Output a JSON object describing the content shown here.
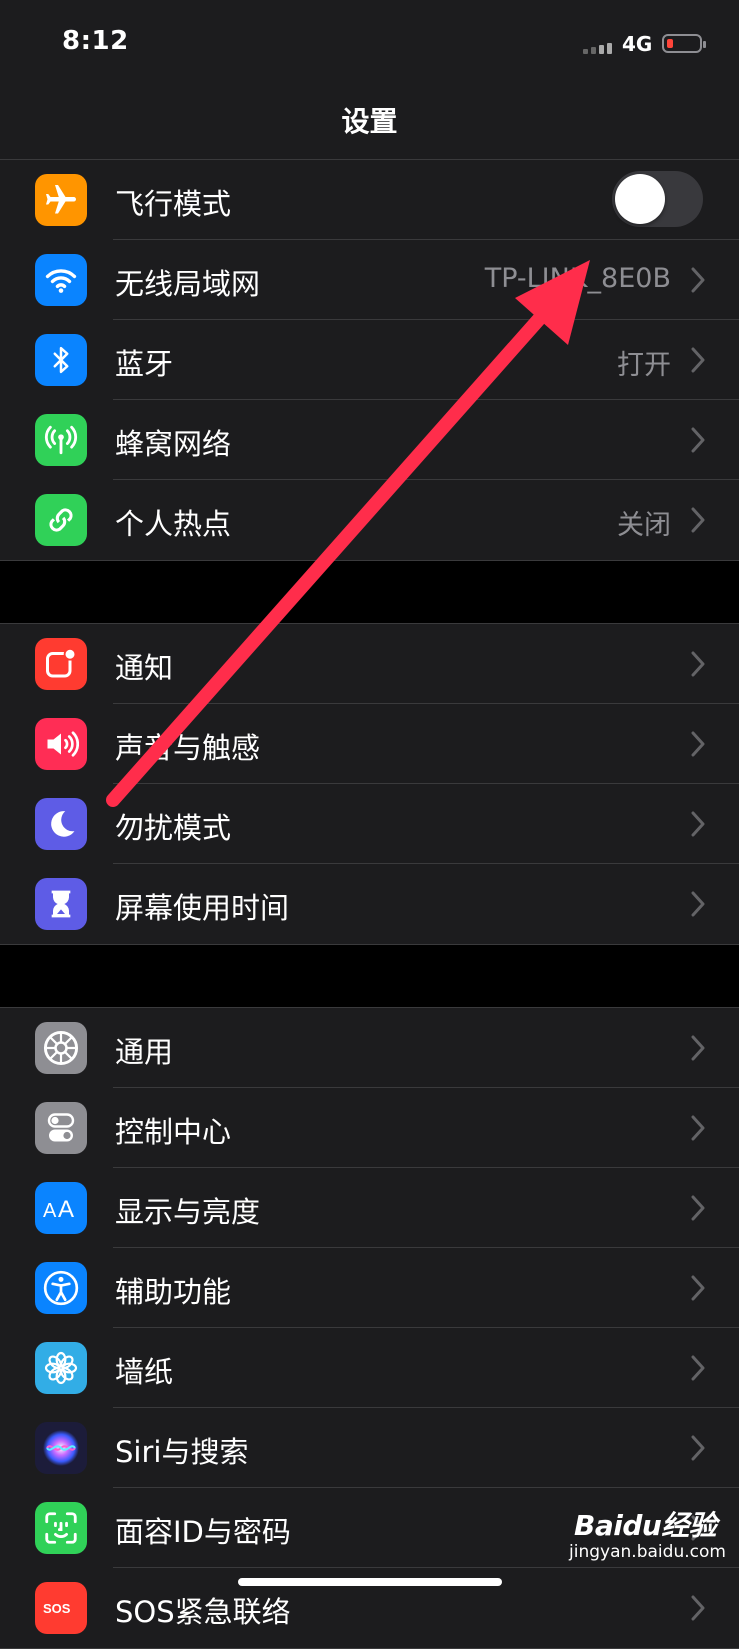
{
  "status_bar": {
    "time": "8:12",
    "network": "4G"
  },
  "nav": {
    "title": "设置"
  },
  "groups": [
    {
      "rows": [
        {
          "key": "airplane",
          "label": "飞行模式",
          "icon": "airplane-icon",
          "icon_color": "#ff9500",
          "toggle": false
        },
        {
          "key": "wifi",
          "label": "无线局域网",
          "value": "TP-LINK_8E0B",
          "icon": "wifi-icon",
          "icon_color": "#0a84ff"
        },
        {
          "key": "bluetooth",
          "label": "蓝牙",
          "value": "打开",
          "icon": "bluetooth-icon",
          "icon_color": "#0a84ff"
        },
        {
          "key": "cellular",
          "label": "蜂窝网络",
          "icon": "antenna-icon",
          "icon_color": "#30d158"
        },
        {
          "key": "hotspot",
          "label": "个人热点",
          "value": "关闭",
          "icon": "hotspot-chain-icon",
          "icon_color": "#30d158"
        }
      ]
    },
    {
      "rows": [
        {
          "key": "notifications",
          "label": "通知",
          "icon": "notification-icon",
          "icon_color": "#ff3b30"
        },
        {
          "key": "sounds",
          "label": "声音与触感",
          "icon": "speaker-icon",
          "icon_color": "#ff2d55"
        },
        {
          "key": "dnd",
          "label": "勿扰模式",
          "icon": "moon-icon",
          "icon_color": "#5e5ce6"
        },
        {
          "key": "screentime",
          "label": "屏幕使用时间",
          "icon": "hourglass-icon",
          "icon_color": "#5e5ce6"
        }
      ]
    },
    {
      "rows": [
        {
          "key": "general",
          "label": "通用",
          "icon": "gear-icon",
          "icon_color": "#8e8e93"
        },
        {
          "key": "control",
          "label": "控制中心",
          "icon": "switches-icon",
          "icon_color": "#8e8e93"
        },
        {
          "key": "display",
          "label": "显示与亮度",
          "icon": "text-size-icon",
          "icon_color": "#0a84ff"
        },
        {
          "key": "accessibility",
          "label": "辅助功能",
          "icon": "accessibility-icon",
          "icon_color": "#0a84ff"
        },
        {
          "key": "wallpaper",
          "label": "墙纸",
          "icon": "flower-icon",
          "icon_color": "#32ade6"
        },
        {
          "key": "siri",
          "label": "Siri与搜索",
          "icon": "siri-icon",
          "icon_color": "#1c1c3a"
        },
        {
          "key": "faceid",
          "label": "面容ID与密码",
          "icon": "face-id-icon",
          "icon_color": "#30d158"
        },
        {
          "key": "sos",
          "label": "SOS紧急联络",
          "icon": "sos-icon",
          "icon_color": "#ff3b30"
        }
      ]
    }
  ],
  "annotation": {
    "arrow_color": "#ff2d4b"
  },
  "watermark": {
    "brand": "Baidu经验",
    "url": "jingyan.baidu.com"
  }
}
